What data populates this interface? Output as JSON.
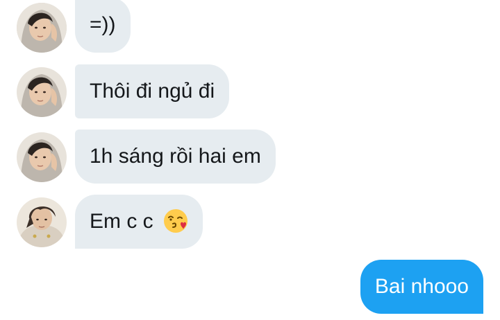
{
  "messages": [
    {
      "sender": "contact-1",
      "text": "=))"
    },
    {
      "sender": "contact-1",
      "text": "Thôi đi ngủ đi"
    },
    {
      "sender": "contact-1",
      "text": "1h sáng rồi hai em"
    },
    {
      "sender": "contact-2",
      "text": "Em c c",
      "emoji": "face-blowing-a-kiss-icon"
    },
    {
      "sender": "me",
      "text": "Bai nhooo"
    }
  ],
  "colors": {
    "incoming_bubble": "#e6ecf0",
    "outgoing_bubble": "#1da1f2",
    "incoming_text": "#14171a",
    "outgoing_text": "#ffffff"
  }
}
